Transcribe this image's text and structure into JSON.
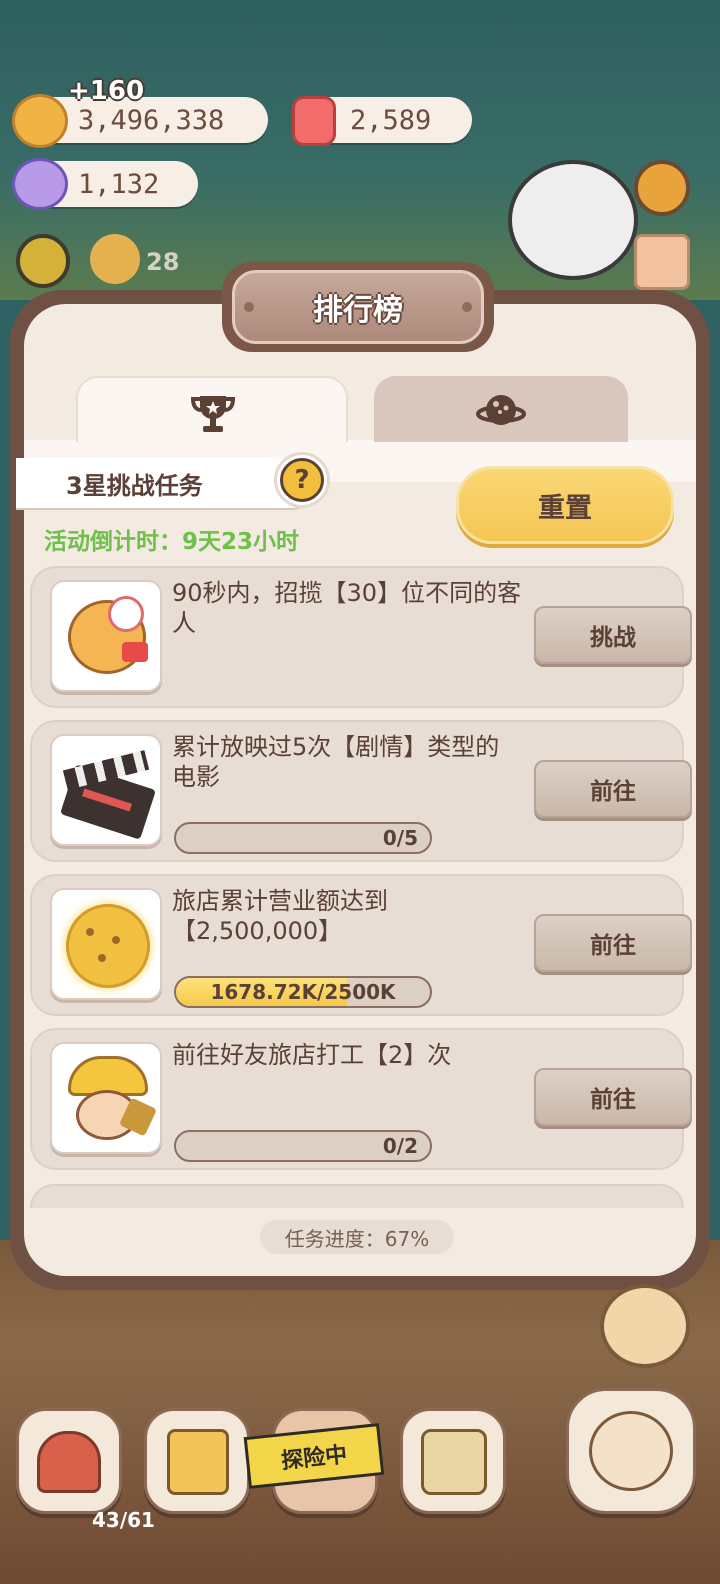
{
  "currency": {
    "cookies_gain": "+160",
    "cookies": "3,496,338",
    "candles": "2,589",
    "candy": "1,132",
    "level_badge": "28"
  },
  "panel": {
    "title": "排行榜",
    "tabs": [
      {
        "icon": "trophy-icon"
      },
      {
        "icon": "planet-icon"
      }
    ],
    "challenge_label": "3星挑战任务",
    "help_symbol": "?",
    "countdown": "活动倒计时：9天23小时",
    "reset_label": "重置",
    "tasks": [
      {
        "desc": "90秒内，招揽【30】位不同的客人",
        "button": "挑战"
      },
      {
        "desc": "累计放映过5次【剧情】类型的电影",
        "button": "前往",
        "progress_text": "0/5",
        "progress_fraction": 0
      },
      {
        "desc": "旅店累计营业额达到【2,500,000】",
        "button": "前往",
        "progress_text": "1678.72K/2500K",
        "progress_fraction": 0.6715
      },
      {
        "desc": "前往好友旅店打工【2】次",
        "button": "前往",
        "progress_text": "0/2",
        "progress_fraction": 0
      }
    ],
    "footer": "任务进度：67%"
  },
  "bottom_bar": {
    "exploring_label": "探险中",
    "counter": "43/61"
  },
  "colors": {
    "accent_yellow": "#f4c654",
    "green_text": "#6fbf49",
    "brown_text": "#5b4035",
    "panel_bg": "#f3eae2"
  }
}
